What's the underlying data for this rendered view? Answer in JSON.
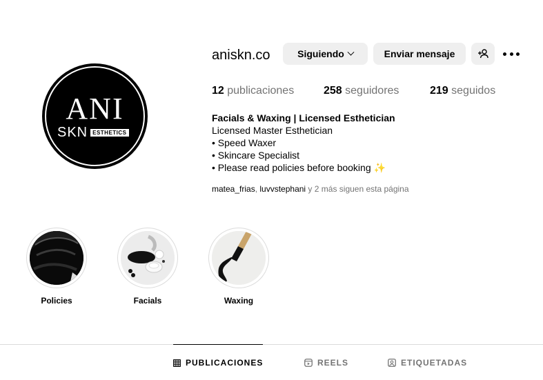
{
  "profile": {
    "username": "aniskn.co",
    "logo_text_main": "ANI",
    "logo_text_sub": "SKN",
    "logo_text_badge": "ESTHETICS",
    "stats": {
      "posts_count": "12",
      "posts_label": "publicaciones",
      "followers_count": "258",
      "followers_label": "seguidores",
      "following_count": "219",
      "following_label": "seguidos"
    },
    "bio": {
      "name": "Facials & Waxing | Licensed Esthetician",
      "line1": "Licensed Master Esthetician",
      "line2": "• Speed Waxer",
      "line3": "• Skincare Specialist",
      "line4": "• Please read policies before booking ",
      "line4_emoji": "✨"
    },
    "followed_by": {
      "user1": "matea_frias",
      "sep": ", ",
      "user2": "luvvstephani",
      "rest": " y 2 más siguen esta página"
    }
  },
  "actions": {
    "following_label": "Siguiendo",
    "message_label": "Enviar mensaje",
    "add_user_icon": "person-plus-icon",
    "more_icon": "more-horizontal-icon"
  },
  "highlights": [
    {
      "label": "Policies"
    },
    {
      "label": "Facials"
    },
    {
      "label": "Waxing"
    }
  ],
  "tabs": [
    {
      "label": "PUBLICACIONES",
      "icon": "grid-icon",
      "active": true
    },
    {
      "label": "REELS",
      "icon": "reels-icon",
      "active": false
    },
    {
      "label": "ETIQUETADAS",
      "icon": "tagged-icon",
      "active": false
    }
  ],
  "colors": {
    "button_bg": "#efefef",
    "secondary_text": "#737373",
    "divider": "#dbdbdb"
  }
}
